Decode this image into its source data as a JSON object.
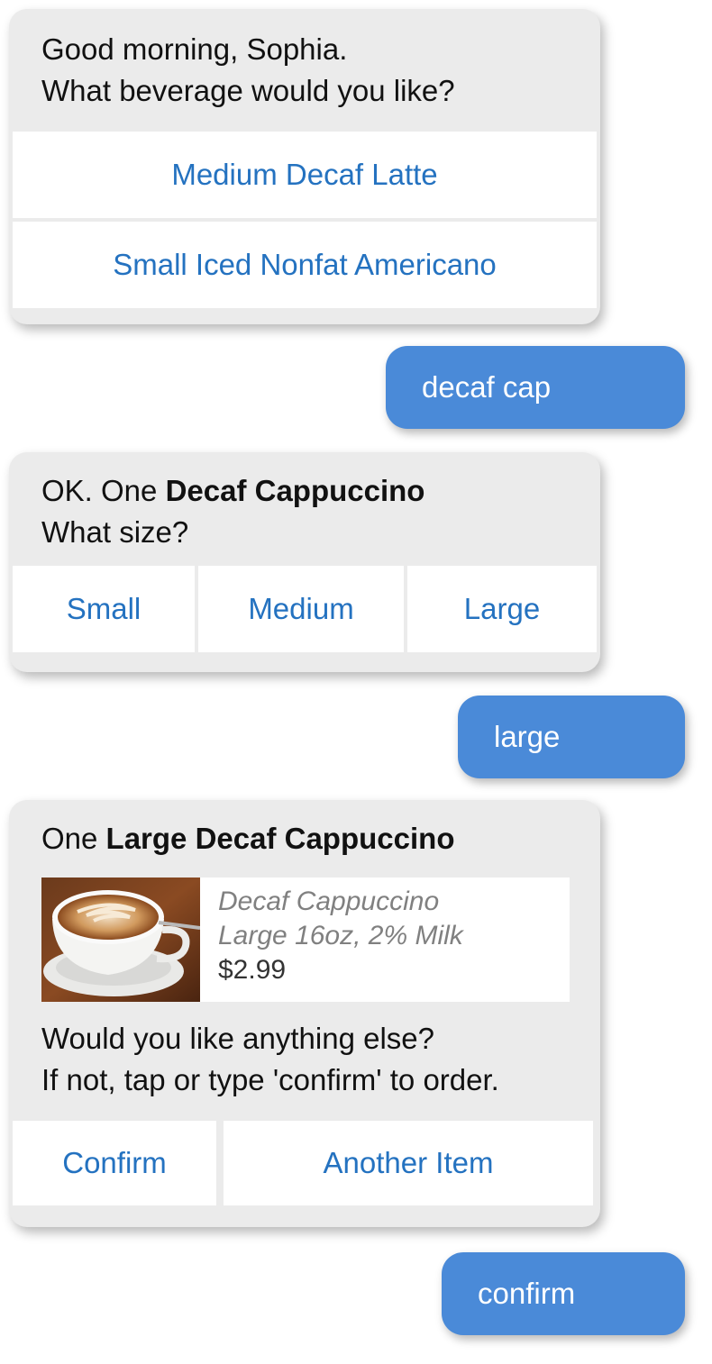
{
  "card1": {
    "line1": "Good morning, Sophia.",
    "line2": "What beverage would you like?",
    "replies": [
      "Medium Decaf Latte",
      "Small Iced Nonfat Americano"
    ]
  },
  "user1": "decaf cap",
  "card2": {
    "prefix": "OK. One",
    "bold": "Decaf Cappuccino",
    "line2": "What size?",
    "replies": [
      "Small",
      "Medium",
      "Large"
    ]
  },
  "user2": "large",
  "card3": {
    "prefix": "One",
    "bold": "Large Decaf Cappuccino",
    "product": {
      "image": "coffee-cup-photo",
      "name": "Decaf Cappuccino",
      "details": "Large 16oz, 2% Milk",
      "price": "$2.99"
    },
    "line2": "Would you like anything else?",
    "line3": "If not, tap or type 'confirm' to order.",
    "replies": [
      "Confirm",
      "Another Item"
    ]
  },
  "user3": "confirm",
  "colors": {
    "bot_bubble": "#ebebeb",
    "user_bubble": "#4a8ad8",
    "reply_text": "#2472c0"
  }
}
